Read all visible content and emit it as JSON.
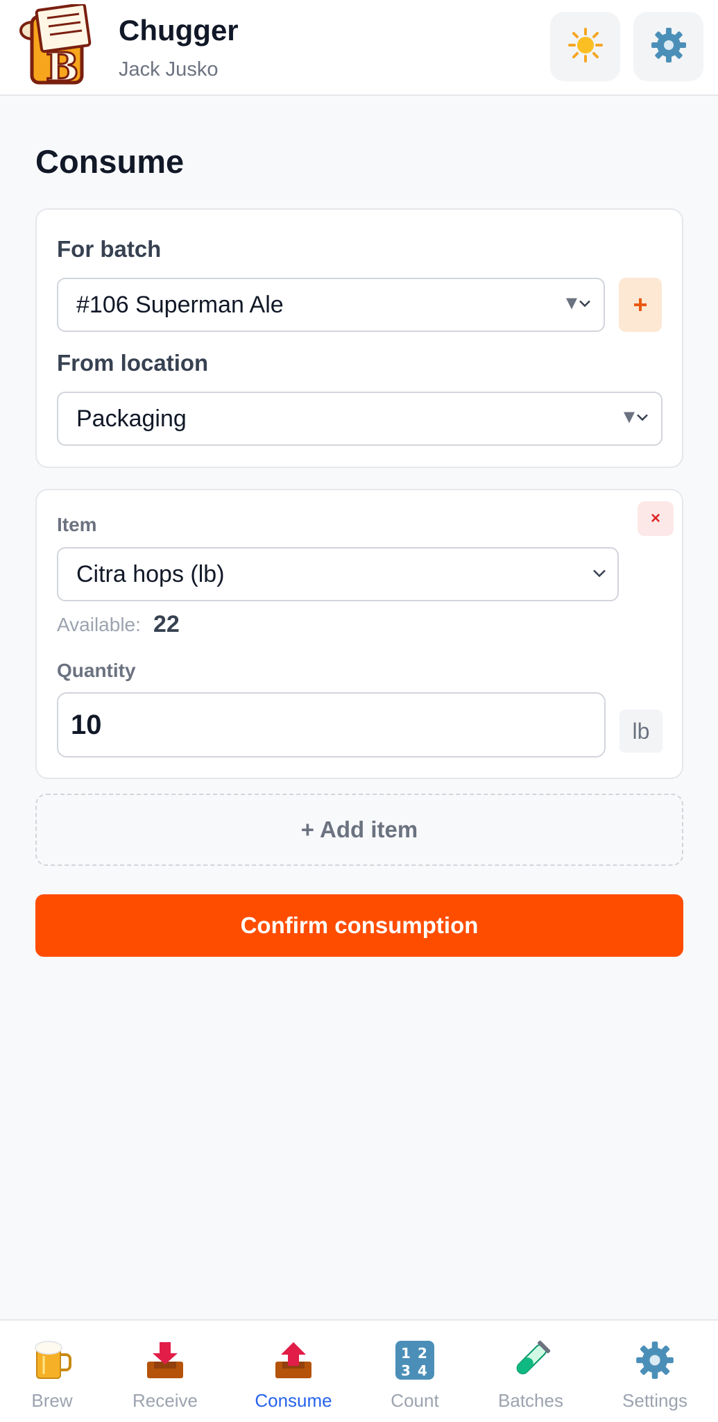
{
  "header": {
    "app_name": "Chugger",
    "user_name": "Jack Jusko"
  },
  "page": {
    "title": "Consume"
  },
  "batch_card": {
    "batch_label": "For batch",
    "batch_value": "#106 Superman Ale",
    "add_batch_label": "+",
    "location_label": "From location",
    "location_value": "Packaging"
  },
  "item_card": {
    "remove_label": "×",
    "item_label": "Item",
    "item_value": "Citra hops (lb)",
    "available_label": "Available:",
    "available_value": "22",
    "quantity_label": "Quantity",
    "quantity_value": "10",
    "unit": "lb"
  },
  "actions": {
    "add_item": "+ Add item",
    "confirm": "Confirm consumption"
  },
  "nav": {
    "items": [
      {
        "label": "Brew",
        "icon": "beer-mug-icon"
      },
      {
        "label": "Receive",
        "icon": "inbox-tray-icon"
      },
      {
        "label": "Consume",
        "icon": "outbox-tray-icon",
        "active": true
      },
      {
        "label": "Count",
        "icon": "numbers-icon"
      },
      {
        "label": "Batches",
        "icon": "test-tube-icon"
      },
      {
        "label": "Settings",
        "icon": "gear-icon"
      }
    ]
  },
  "colors": {
    "accent": "#ff4d00",
    "active_nav": "#2563eb"
  }
}
